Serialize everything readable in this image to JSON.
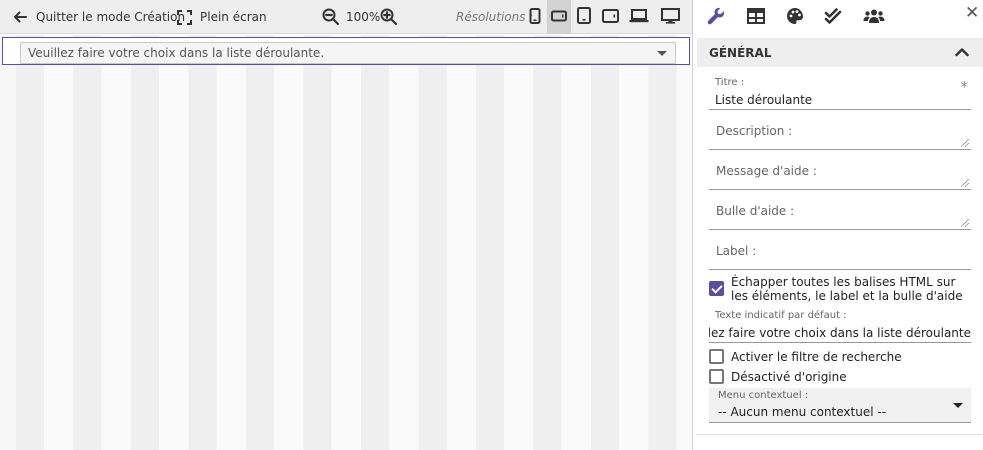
{
  "toolbar": {
    "back_label": "Quitter le mode Création",
    "fullscreen_label": "Plein écran",
    "zoom_value": "100%",
    "resolutions_label": "Résolutions :"
  },
  "canvas": {
    "dropdown_placeholder": "Veuillez faire votre choix dans la liste déroulante."
  },
  "panel": {
    "section_title": "GÉNÉRAL",
    "title_label": "Titre :",
    "title_value": "Liste déroulante",
    "required_mark": "*",
    "description_placeholder": "Description :",
    "help_message_placeholder": "Message d'aide :",
    "tooltip_placeholder": "Bulle d'aide :",
    "label_placeholder": "Label :",
    "escape_html_label": "Échapper toutes les balises HTML sur les éléments, le label et la bulle d'aide",
    "escape_html_checked": true,
    "default_hint_label": "Texte indicatif par défaut :",
    "default_hint_value": "Veuillez faire votre choix dans la liste déroulante.",
    "search_filter_label": "Activer le filtre de recherche",
    "search_filter_checked": false,
    "disabled_label": "Désactivé d'origine",
    "disabled_checked": false,
    "context_menu_label": "Menu contextuel :",
    "context_menu_value": "-- Aucun menu contextuel --"
  },
  "colors": {
    "accent": "#5b4ea1",
    "toolbar_bg": "#eeeeee",
    "icon": "#333333"
  }
}
